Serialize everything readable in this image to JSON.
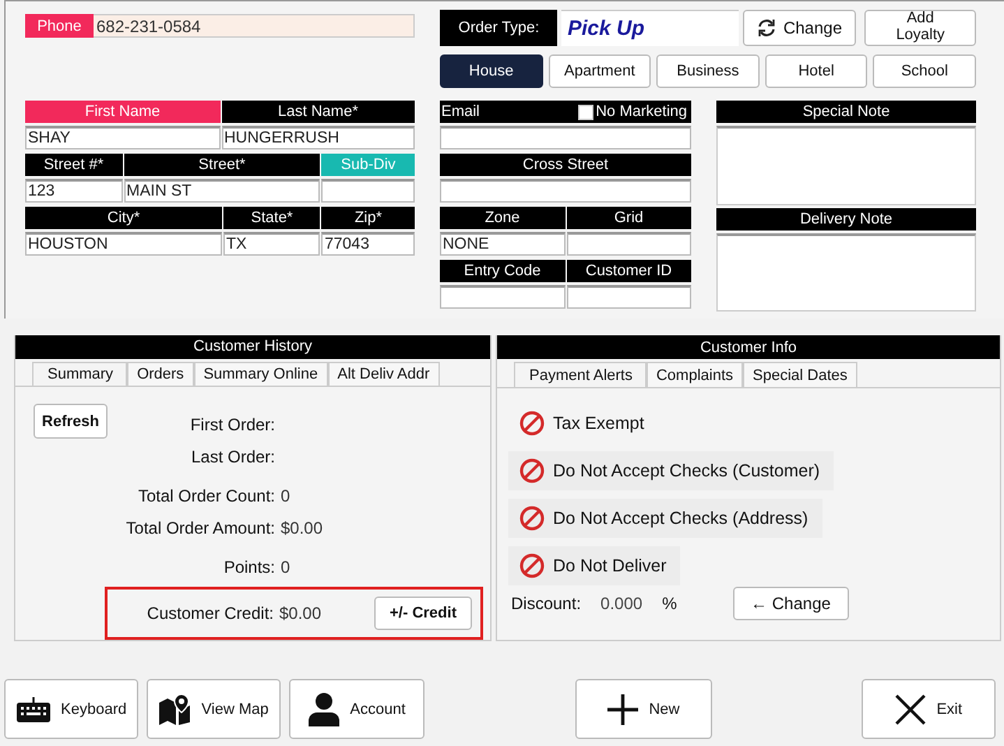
{
  "phone": {
    "label": "Phone",
    "color": "#f2295b",
    "value": "682-231-0584"
  },
  "order_type": {
    "label": "Order Type:",
    "value": "Pick Up"
  },
  "change_button": "Change",
  "add_loyalty_button": "Add Loyalty",
  "address_types": [
    {
      "label": "House",
      "selected": true
    },
    {
      "label": "Apartment",
      "selected": false
    },
    {
      "label": "Business",
      "selected": false
    },
    {
      "label": "Hotel",
      "selected": false
    },
    {
      "label": "School",
      "selected": false
    }
  ],
  "customer_fields": [
    [
      {
        "label": "First Name",
        "color": "#f2295b",
        "value": "SHAY"
      },
      {
        "label": "Last Name*",
        "color": "#000000",
        "value": "HUNGERRUSH"
      }
    ],
    [
      {
        "label": "Street #*",
        "color": "#000000",
        "value": "123"
      },
      {
        "label": "Street*",
        "color": "#000000",
        "value": "MAIN ST"
      },
      {
        "label": "Sub-Div",
        "color": "#18b9b0"
      }
    ],
    [
      {
        "label": "City*",
        "color": "#000000",
        "value": "HOUSTON"
      },
      {
        "label": "State*",
        "color": "#000000",
        "value": "TX"
      },
      {
        "label": "Zip*",
        "color": "#000000",
        "value": "77043"
      }
    ]
  ],
  "email": {
    "label": "Email",
    "no_marketing": {
      "label": "No Marketing",
      "checked": false
    }
  },
  "cross_street": {
    "label": "Cross Street"
  },
  "location_fields": [
    [
      {
        "label": "Zone",
        "value": "NONE"
      },
      {
        "label": "Grid"
      }
    ],
    [
      {
        "label": "Entry Code"
      },
      {
        "label": "Customer ID"
      }
    ]
  ],
  "notes": [
    {
      "label": "Special Note"
    },
    {
      "label": "Delivery Note"
    }
  ],
  "customer_history": {
    "title": "Customer History",
    "tabs": [
      {
        "label": "Summary",
        "selected": true
      },
      {
        "label": "Orders",
        "selected": false
      },
      {
        "label": "Summary Online",
        "selected": false
      },
      {
        "label": "Alt Deliv Addr",
        "selected": false
      }
    ],
    "refresh_button": "Refresh",
    "stats": [
      {
        "label": "First Order:"
      },
      {
        "label": "Last Order:"
      },
      {
        "label": "Total Order Count:",
        "value": "0"
      },
      {
        "label": "Total Order Amount:",
        "value": "$0.00"
      },
      {
        "label": "Points:",
        "value": "0"
      }
    ],
    "customer_credit": {
      "label": "Customer Credit:",
      "value": "$0.00",
      "button": "+/- Credit"
    }
  },
  "customer_info": {
    "title": "Customer Info",
    "tabs": [
      {
        "label": "Payment Alerts",
        "selected": true
      },
      {
        "label": "Complaints",
        "selected": false
      },
      {
        "label": "Special Dates",
        "selected": false
      }
    ],
    "alerts": [
      "Tax Exempt",
      "Do Not Accept Checks (Customer)",
      "Do Not Accept Checks (Address)",
      "Do Not Deliver"
    ],
    "discount": {
      "label": "Discount:",
      "value": "0.000",
      "unit": "%",
      "button": "← Change"
    }
  },
  "bottom_buttons": [
    {
      "kind": "keyboard",
      "label": "Keyboard"
    },
    {
      "kind": "map",
      "label": "View Map"
    },
    {
      "kind": "account",
      "label": "Account"
    },
    {
      "kind": "new",
      "label": "New"
    },
    {
      "kind": "exit",
      "label": "Exit"
    }
  ]
}
